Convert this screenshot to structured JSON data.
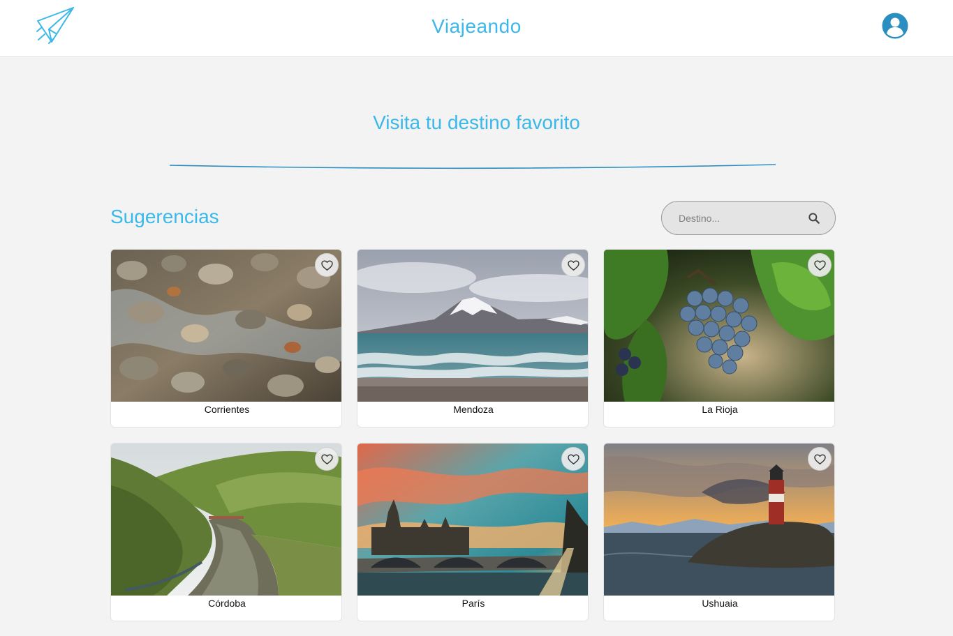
{
  "header": {
    "brand": "Viajeando",
    "logo_icon": "paper-plane-icon",
    "profile_icon": "account-circle-icon"
  },
  "hero": {
    "title": "Visita tu destino favorito"
  },
  "section": {
    "title": "Sugerencias"
  },
  "search": {
    "placeholder": "Destino...",
    "value": "",
    "icon": "search-icon"
  },
  "cards": [
    {
      "label": "Corrientes",
      "image": "rocky-stream-photo",
      "favorite_icon": "heart-outline-icon"
    },
    {
      "label": "Mendoza",
      "image": "volcano-lake-photo",
      "favorite_icon": "heart-outline-icon"
    },
    {
      "label": "La Rioja",
      "image": "grapes-vineyard-photo",
      "favorite_icon": "heart-outline-icon"
    },
    {
      "label": "Córdoba",
      "image": "river-valley-photo",
      "favorite_icon": "heart-outline-icon"
    },
    {
      "label": "París",
      "image": "sunset-bridge-photo",
      "favorite_icon": "heart-outline-icon"
    },
    {
      "label": "Ushuaia",
      "image": "lighthouse-sunset-photo",
      "favorite_icon": "heart-outline-icon"
    }
  ],
  "colors": {
    "accent": "#3bb8ea",
    "accent_dark": "#2a8fc0",
    "background": "#f3f3f3",
    "card_background": "#ffffff"
  }
}
